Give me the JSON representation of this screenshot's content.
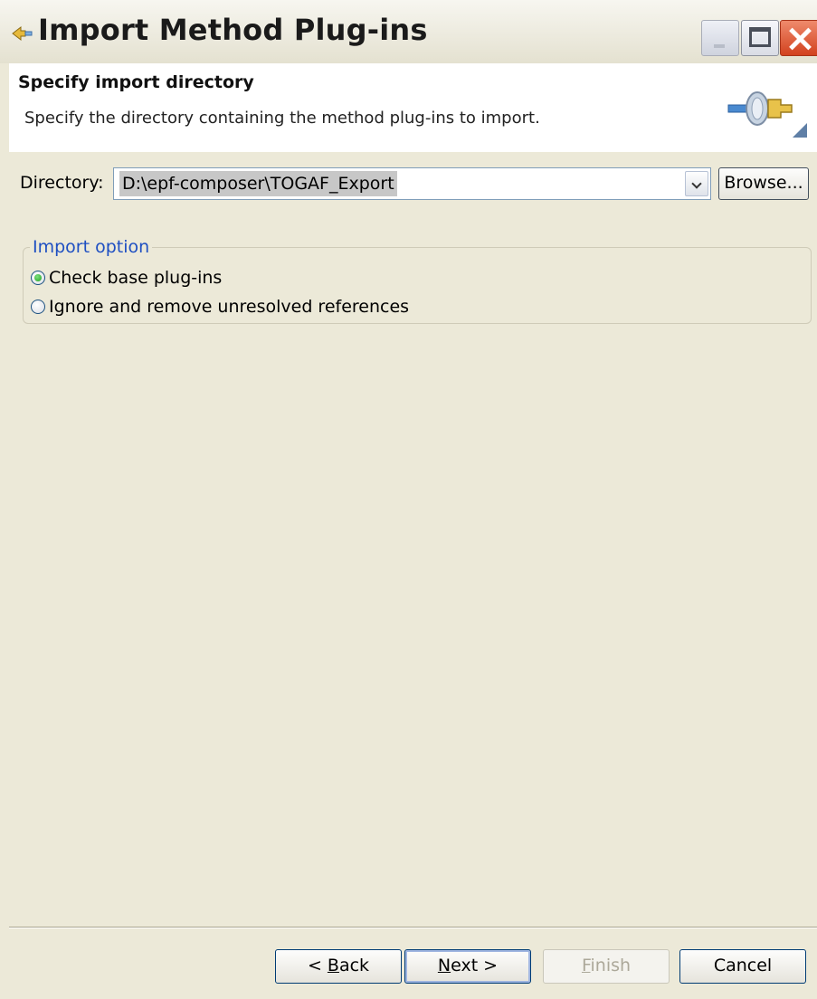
{
  "window": {
    "title": "Import Method Plug-ins"
  },
  "header": {
    "title": "Specify import directory",
    "description": "Specify the directory containing the method plug-ins to import."
  },
  "directory": {
    "label": "Directory:",
    "value": "D:\\epf-composer\\TOGAF_Export",
    "browse_label": "Browse..."
  },
  "import_option": {
    "legend": "Import option",
    "options": [
      {
        "label": "Check base plug-ins",
        "selected": true
      },
      {
        "label": "Ignore and remove unresolved references",
        "selected": false
      }
    ]
  },
  "buttons": {
    "back": {
      "prefix": "< ",
      "mnemonic": "B",
      "rest": "ack"
    },
    "next": {
      "mnemonic": "N",
      "rest": "ext >"
    },
    "finish": {
      "mnemonic": "F",
      "rest": "inish",
      "enabled": false
    },
    "cancel": "Cancel"
  },
  "colors": {
    "dialog_bg": "#ece9d8",
    "legend_text": "#1e4fc2",
    "close_button": "#d2421f"
  }
}
